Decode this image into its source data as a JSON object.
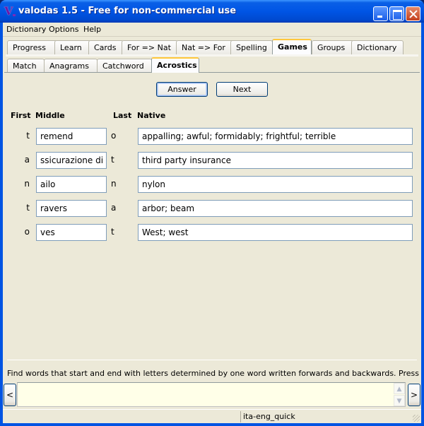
{
  "window": {
    "title": "valodas 1.5 - Free for non-commercial use",
    "icon": "app-icon-V",
    "controls": [
      "minimize",
      "maximize",
      "close"
    ]
  },
  "menu": [
    "Dictionary",
    "Options",
    "Help"
  ],
  "main_tabs": [
    {
      "label": "Progress",
      "active": false
    },
    {
      "label": "Learn",
      "active": false
    },
    {
      "label": "Cards",
      "active": false
    },
    {
      "label": "For => Nat",
      "active": false
    },
    {
      "label": "Nat => For",
      "active": false
    },
    {
      "label": "Spelling",
      "active": false
    },
    {
      "label": "Games",
      "active": true
    },
    {
      "label": "Groups",
      "active": false
    },
    {
      "label": "Dictionary",
      "active": false
    }
  ],
  "sub_tabs": [
    {
      "label": "Match",
      "active": false
    },
    {
      "label": "Anagrams",
      "active": false
    },
    {
      "label": "Catchword",
      "active": false
    },
    {
      "label": "Acrostics",
      "active": true
    }
  ],
  "buttons": {
    "answer": "Answer",
    "next": "Next"
  },
  "columns": {
    "first": "First",
    "middle": "Middle",
    "last": "Last",
    "native": "Native"
  },
  "rows": [
    {
      "first": "t",
      "middle": "remend",
      "last": "o",
      "native": "appalling; awful; formidably; frightful; terrible"
    },
    {
      "first": "a",
      "middle": "ssicurazione di",
      "last": "t",
      "native": "third party insurance"
    },
    {
      "first": "n",
      "middle": "ailo",
      "last": "n",
      "native": "nylon"
    },
    {
      "first": "t",
      "middle": "ravers",
      "last": "a",
      "native": "arbor; beam"
    },
    {
      "first": "o",
      "middle": "ves",
      "last": "t",
      "native": "West; west"
    }
  ],
  "hint": "Find words that start and end with letters determined by one word written forwards and backwards. Press enter after typ",
  "input": {
    "value": "",
    "prev_label": "<",
    "next_label": ">"
  },
  "status": {
    "dictionary": "ita-eng_quick"
  }
}
